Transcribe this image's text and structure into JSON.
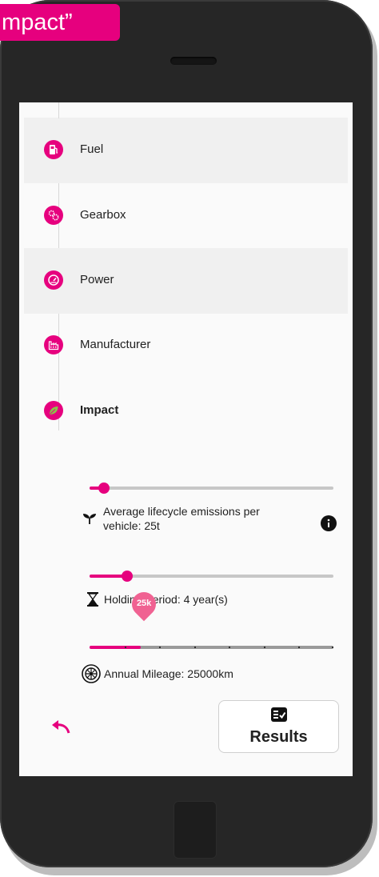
{
  "header": {
    "title": "Impact”"
  },
  "steps": [
    {
      "label": "Fuel",
      "icon": "fuel-icon"
    },
    {
      "label": "Gearbox",
      "icon": "gears-icon"
    },
    {
      "label": "Power",
      "icon": "speedometer-icon"
    },
    {
      "label": "Manufacturer",
      "icon": "factory-icon"
    },
    {
      "label": "Impact",
      "icon": "leaf-icon"
    }
  ],
  "emissions": {
    "label_line1": "Average lifecycle emissions per",
    "label_line2": "vehicle: 25t",
    "value_fraction": 0.06,
    "icon": "sprout-icon",
    "info_icon": "info-icon"
  },
  "holding": {
    "label": "Holding Period: 4 year(s)",
    "value_fraction": 0.155,
    "icon": "hourglass-icon"
  },
  "mileage": {
    "label": "Annual Mileage: 25000km",
    "pin_label": "25k",
    "value_fraction": 0.21,
    "steps": 7,
    "icon": "tire-icon"
  },
  "actions": {
    "undo_icon": "undo-icon",
    "results_icon": "checklist-icon",
    "results_label": "Results"
  },
  "colors": {
    "accent": "#e6007e",
    "pin": "#f06292",
    "impact_leaf": "#8bc34a"
  }
}
